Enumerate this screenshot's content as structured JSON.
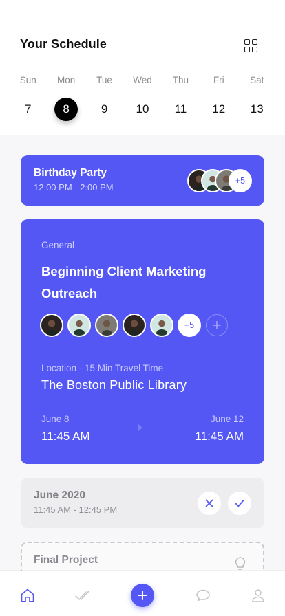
{
  "header": {
    "title": "Your Schedule",
    "grid_icon": "grid-icon"
  },
  "week": {
    "days": [
      {
        "name": "Sun",
        "num": "7"
      },
      {
        "name": "Mon",
        "num": "8"
      },
      {
        "name": "Tue",
        "num": "9"
      },
      {
        "name": "Wed",
        "num": "10"
      },
      {
        "name": "Thu",
        "num": "11"
      },
      {
        "name": "Fri",
        "num": "12"
      },
      {
        "name": "Sat",
        "num": "13"
      }
    ],
    "selected": "8"
  },
  "birthday": {
    "title": "Birthday Party",
    "time": "12:00 PM - 2:00 PM",
    "extra_count": "+5"
  },
  "main_event": {
    "category": "General",
    "title": "Beginning Client Marketing Outreach",
    "extra_count": "+5",
    "location_label": "Location - 15 Min Travel Time",
    "location": "The Boston Public Library",
    "start_date": "June 8",
    "start_time": "11:45 AM",
    "end_date": "June 12",
    "end_time": "11:45 AM"
  },
  "june_card": {
    "title": "June 2020",
    "time": "11:45 AM - 12:45 PM"
  },
  "final_card": {
    "title": "Final Project"
  },
  "colors": {
    "accent": "#5457f3",
    "background": "#f7f7f9",
    "muted_card": "#ededf0"
  },
  "nav": {
    "items": [
      "home-icon",
      "check-icon",
      "add-icon",
      "chat-icon",
      "profile-icon"
    ]
  }
}
